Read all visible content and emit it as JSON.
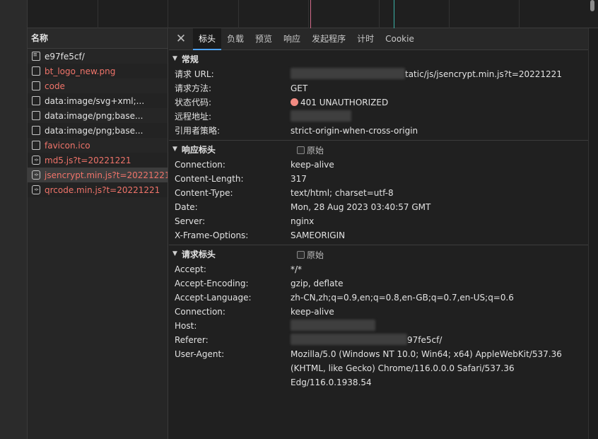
{
  "name_panel": {
    "header": "名称",
    "requests": [
      {
        "name": "e97fe5cf/",
        "icon": "document-icon",
        "error": false
      },
      {
        "name": "bt_logo_new.png",
        "icon": "file-icon",
        "error": true
      },
      {
        "name": "code",
        "icon": "file-icon",
        "error": true
      },
      {
        "name": "data:image/svg+xml;...",
        "icon": "file-icon",
        "error": false
      },
      {
        "name": "data:image/png;base...",
        "icon": "file-icon",
        "error": false
      },
      {
        "name": "data:image/png;base...",
        "icon": "file-icon",
        "error": false
      },
      {
        "name": "favicon.ico",
        "icon": "checkbox-icon",
        "error": true
      },
      {
        "name": "md5.js?t=20221221",
        "icon": "script-icon",
        "error": true
      },
      {
        "name": "jsencrypt.min.js?t=20221221",
        "icon": "script-icon",
        "error": true,
        "selected": true
      },
      {
        "name": "qrcode.min.js?t=20221221",
        "icon": "script-icon",
        "error": true
      }
    ]
  },
  "tabs": [
    "标头",
    "负载",
    "预览",
    "响应",
    "发起程序",
    "计时",
    "Cookie"
  ],
  "active_tab": "标头",
  "general": {
    "title": "常规",
    "rows": [
      {
        "key": "请求 URL:",
        "value": "tatic/js/jsencrypt.min.js?t=20221221"
      },
      {
        "key": "请求方法:",
        "value": "GET"
      },
      {
        "key": "状态代码:",
        "value": "401 UNAUTHORIZED"
      },
      {
        "key": "远程地址:",
        "value": ""
      },
      {
        "key": "引用者策略:",
        "value": "strict-origin-when-cross-origin"
      }
    ]
  },
  "response_headers": {
    "title": "响应标头",
    "raw_label": "原始",
    "rows": [
      {
        "key": "Connection:",
        "value": "keep-alive"
      },
      {
        "key": "Content-Length:",
        "value": "317"
      },
      {
        "key": "Content-Type:",
        "value": "text/html; charset=utf-8"
      },
      {
        "key": "Date:",
        "value": "Mon, 28 Aug 2023 03:40:57 GMT"
      },
      {
        "key": "Server:",
        "value": "nginx"
      },
      {
        "key": "X-Frame-Options:",
        "value": "SAMEORIGIN"
      }
    ]
  },
  "request_headers": {
    "title": "请求标头",
    "raw_label": "原始",
    "rows": [
      {
        "key": "Accept:",
        "value": "*/*"
      },
      {
        "key": "Accept-Encoding:",
        "value": "gzip, deflate"
      },
      {
        "key": "Accept-Language:",
        "value": "zh-CN,zh;q=0.9,en;q=0.8,en-GB;q=0.7,en-US;q=0.6"
      },
      {
        "key": "Connection:",
        "value": "keep-alive"
      },
      {
        "key": "Host:",
        "value": ""
      },
      {
        "key": "Referer:",
        "value": "97fe5cf/"
      },
      {
        "key": "User-Agent:",
        "value": "Mozilla/5.0 (Windows NT 10.0; Win64; x64) AppleWebKit/537.36 (KHTML, like Gecko) Chrome/116.0.0.0 Safari/537.36 Edg/116.0.1938.54"
      }
    ]
  },
  "colors": {
    "error_text": "#f0746a",
    "status_dot": "#f28b82",
    "active_tab_underline": "#4fa3f7"
  }
}
